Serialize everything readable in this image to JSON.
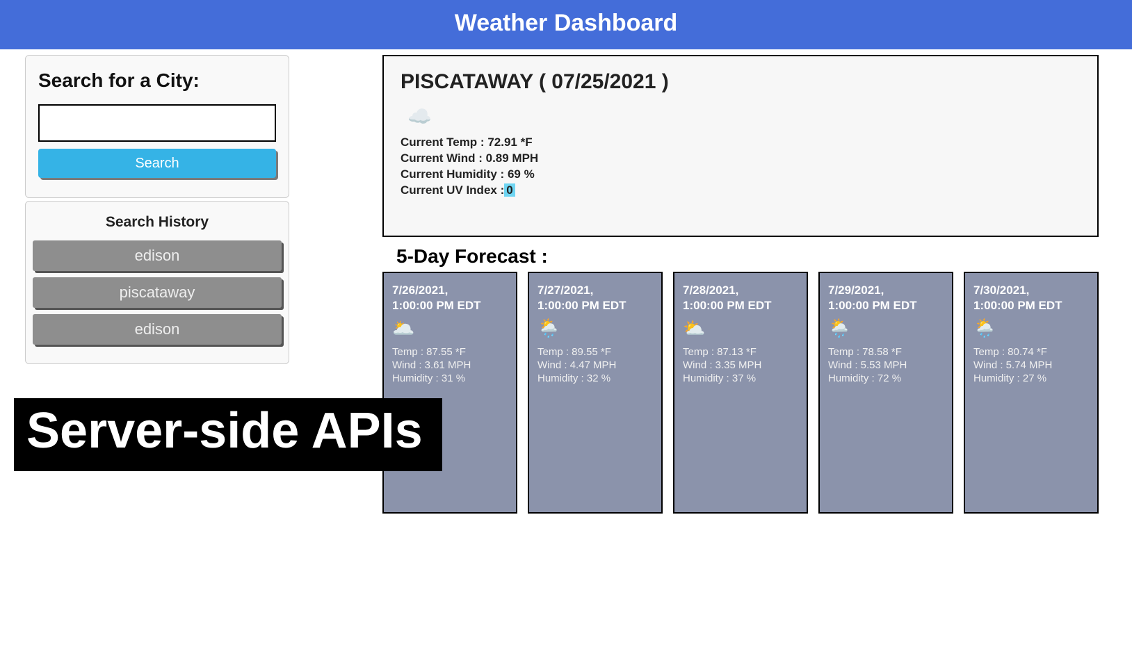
{
  "header": {
    "title": "Weather Dashboard"
  },
  "search": {
    "title": "Search for a City:",
    "value": "",
    "button": "Search"
  },
  "history": {
    "title": "Search History",
    "items": [
      "edison",
      "piscataway",
      "edison"
    ]
  },
  "current": {
    "title": "PISCATAWAY ( 07/25/2021 )",
    "icon": "☁️",
    "temp_label": "Current Temp : ",
    "temp_value": "72.91 *F",
    "wind_label": "Current Wind : ",
    "wind_value": "0.89 MPH",
    "humidity_label": "Current Humidity : ",
    "humidity_value": "69 %",
    "uv_label": "Current UV Index :",
    "uv_value": "0"
  },
  "forecast": {
    "title": "5-Day Forecast :",
    "days": [
      {
        "date_l1": "7/26/2021,",
        "date_l2": "1:00:00 PM EDT",
        "icon": "🌥️",
        "temp": "Temp : 87.55 *F",
        "wind": "Wind : 3.61 MPH",
        "humidity": "Humidity : 31 %"
      },
      {
        "date_l1": "7/27/2021,",
        "date_l2": "1:00:00 PM EDT",
        "icon": "🌦️",
        "temp": "Temp : 89.55 *F",
        "wind": "Wind : 4.47 MPH",
        "humidity": "Humidity : 32 %"
      },
      {
        "date_l1": "7/28/2021,",
        "date_l2": "1:00:00 PM EDT",
        "icon": "⛅",
        "temp": "Temp : 87.13 *F",
        "wind": "Wind : 3.35 MPH",
        "humidity": "Humidity : 37 %"
      },
      {
        "date_l1": "7/29/2021,",
        "date_l2": "1:00:00 PM EDT",
        "icon": "🌦️",
        "temp": "Temp : 78.58 *F",
        "wind": "Wind : 5.53 MPH",
        "humidity": "Humidity : 72 %"
      },
      {
        "date_l1": "7/30/2021,",
        "date_l2": "1:00:00 PM EDT",
        "icon": "🌦️",
        "temp": "Temp : 80.74 *F",
        "wind": "Wind : 5.74 MPH",
        "humidity": "Humidity : 27 %"
      }
    ]
  },
  "overlay": {
    "text": "Server-side APIs"
  }
}
